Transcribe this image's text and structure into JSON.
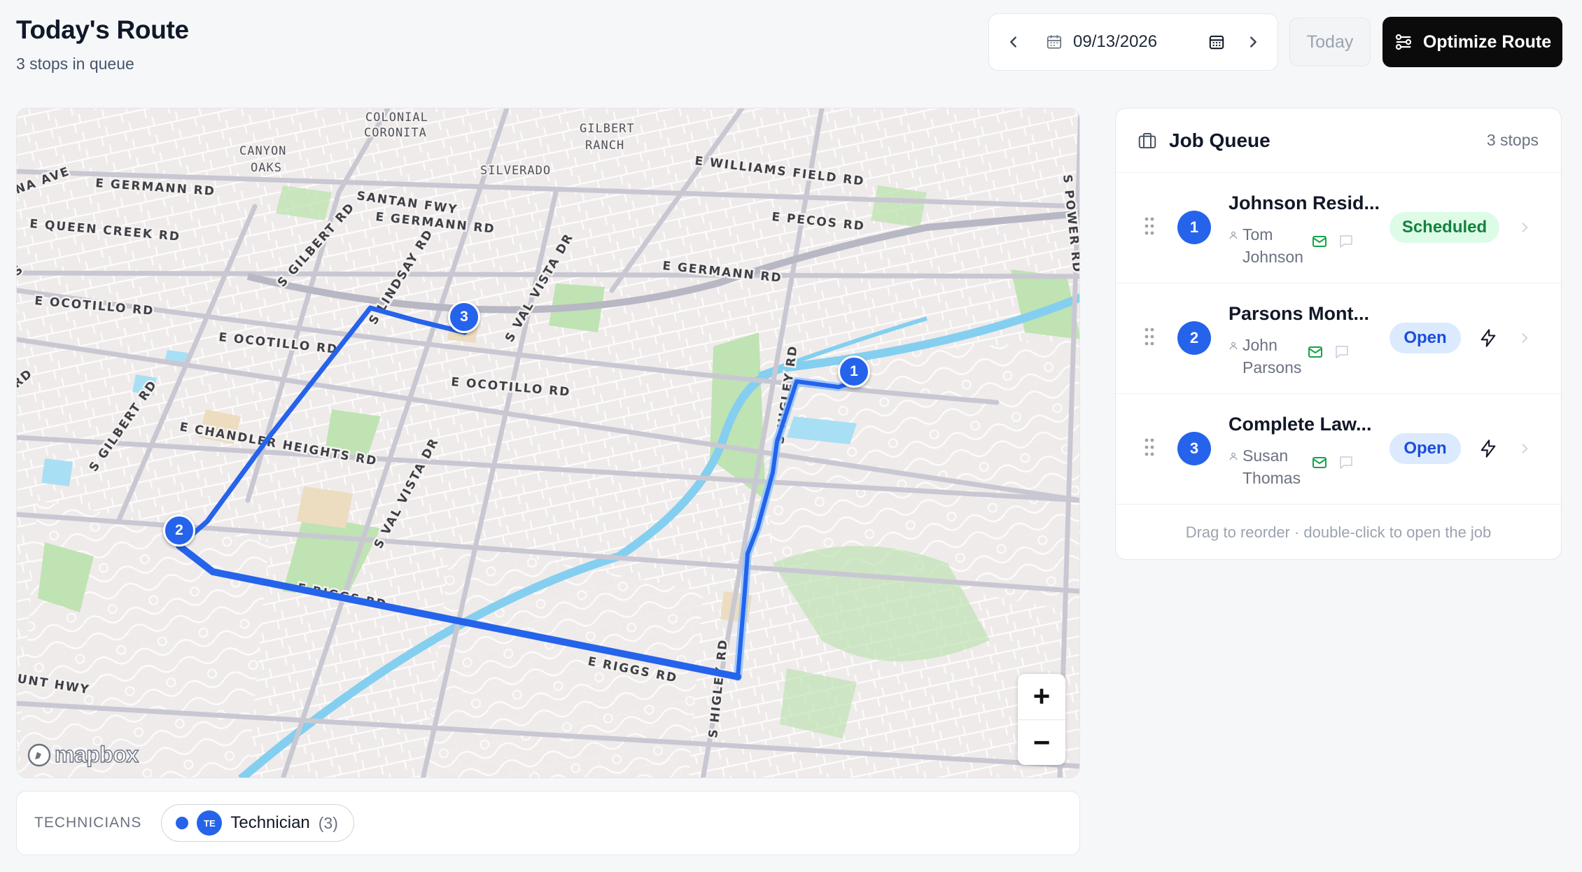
{
  "page": {
    "title": "Today's Route",
    "subtitle": "3 stops in queue"
  },
  "date_nav": {
    "date": "09/13/2026",
    "icons": {
      "prev": "chevron-left-icon",
      "next": "chevron-right-icon",
      "date": "calendar-icon",
      "picker": "calendar-grid-icon"
    }
  },
  "toolbar": {
    "today_label": "Today",
    "optimize_label": "Optimize Route",
    "optimize_icon": "sliders-icon"
  },
  "map": {
    "logo_text": "mapbox",
    "zoom_in": "+",
    "zoom_out": "−",
    "route_color": "#2563eb",
    "road_labels": [
      "E GERMANN RD",
      "E QUEEN CREEK RD",
      "E OCOTILLO RD",
      "E OCOTILLO RD",
      "E OCOTILLO RD",
      "E CHANDLER HEIGHTS RD",
      "E RIGGS RD",
      "E RIGGS RD",
      "SANTAN FWY",
      "E GERMANN RD",
      "E GERMANN RD",
      "E WILLIAMS FIELD RD",
      "E PECOS RD",
      "S GILBERT RD",
      "S GILBERT RD",
      "S LINDSAY RD",
      "S VAL VISTA DR",
      "S VAL VISTA DR",
      "S HIGLEY RD",
      "S HIGLEY RD",
      "S POWER RD",
      "UNT HWY",
      "NA AVE",
      "RD",
      "S"
    ],
    "area_labels": [
      "COLONIAL",
      "CORONITA",
      "CANYON",
      "OAKS",
      "GILBERT",
      "RANCH",
      "SILVERADO"
    ],
    "markers": [
      "1",
      "2",
      "3"
    ]
  },
  "technicians": {
    "label": "TECHNICIANS",
    "items": [
      {
        "initials": "TE",
        "name": "Technician",
        "count": "(3)",
        "color": "#2563eb"
      }
    ]
  },
  "queue": {
    "title": "Job Queue",
    "count": "3 stops",
    "icon": "briefcase-icon",
    "footer": "Drag to reorder · double-click to open the job",
    "jobs": [
      {
        "number": "1",
        "title": "Johnson Resid...",
        "contact": "Tom Johnson",
        "status": "Scheduled",
        "status_color": "#15803d"
      },
      {
        "number": "2",
        "title": "Parsons Mont...",
        "contact": "John Parsons",
        "status": "Open",
        "status_color": "#1d4ed8"
      },
      {
        "number": "3",
        "title": "Complete Law...",
        "contact": "Susan Thomas",
        "status": "Open",
        "status_color": "#1d4ed8"
      }
    ]
  }
}
